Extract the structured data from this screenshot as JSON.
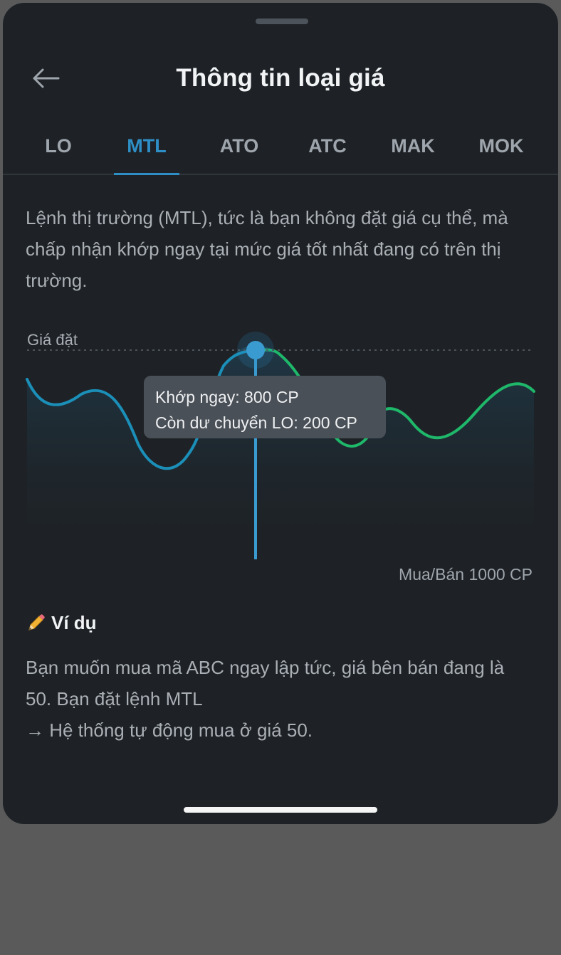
{
  "header": {
    "title": "Thông tin loại giá"
  },
  "tabs": [
    {
      "label": "LO"
    },
    {
      "label": "MTL",
      "active": true
    },
    {
      "label": "ATO"
    },
    {
      "label": "ATC"
    },
    {
      "label": "MAK"
    },
    {
      "label": "MOK"
    }
  ],
  "description": "Lệnh thị trường (MTL), tức là bạn không đặt giá cụ thể, mà chấp nhận khớp ngay tại mức giá tốt nhất đang có trên thị trường.",
  "chart": {
    "price_label": "Giá đặt",
    "tooltip": {
      "line1": "Khớp ngay: 800 CP",
      "line2": "Còn dư chuyển LO: 200 CP"
    },
    "volume_label": "Mua/Bán 1000 CP"
  },
  "example": {
    "heading": "Ví dụ",
    "line1": "Bạn muốn mua mã ABC ngay lập tức, giá bên bán đang là 50. Bạn đặt lệnh MTL",
    "line2": "→ Hệ thống tự động mua ở giá 50."
  },
  "colors": {
    "accent": "#2e8fc7",
    "line_blue": "#1b8fb8",
    "line_green": "#1fb86a",
    "background": "#1e2226"
  },
  "icons": {
    "back": "arrow-left-icon",
    "example": "pencil-icon"
  }
}
